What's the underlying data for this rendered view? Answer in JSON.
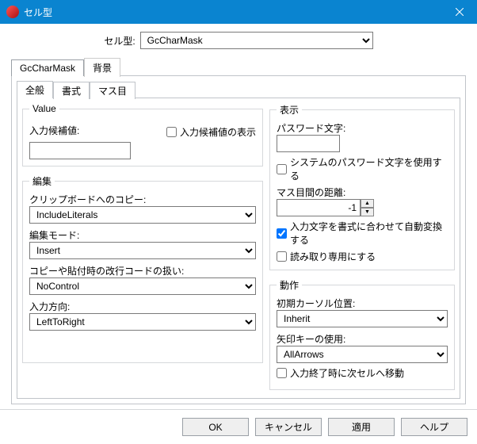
{
  "titlebar": {
    "title": "セル型"
  },
  "celltype": {
    "label": "セル型:",
    "value": "GcCharMask"
  },
  "mainTabs": [
    {
      "label": "GcCharMask"
    },
    {
      "label": "背景"
    }
  ],
  "subTabs": [
    {
      "label": "全般"
    },
    {
      "label": "書式"
    },
    {
      "label": "マス目"
    }
  ],
  "value": {
    "legend": "Value",
    "input_label": "入力候補値:",
    "input_value": "",
    "show_chk": "入力候補値の表示"
  },
  "edit": {
    "legend": "編集",
    "clipboard_label": "クリップボードへのコピー:",
    "clipboard_value": "IncludeLiterals",
    "editmode_label": "編集モード:",
    "editmode_value": "Insert",
    "linebreak_label": "コピーや貼付時の改行コードの扱い:",
    "linebreak_value": "NoControl",
    "direction_label": "入力方向:",
    "direction_value": "LeftToRight"
  },
  "display": {
    "legend": "表示",
    "password_label": "パスワード文字:",
    "password_value": "",
    "syspw_chk": "システムのパスワード文字を使用する",
    "spacing_label": "マス目間の距離:",
    "spacing_value": "-1",
    "autoconvert_chk": "入力文字を書式に合わせて自動変換する",
    "readonly_chk": "読み取り専用にする"
  },
  "action": {
    "legend": "動作",
    "cursor_label": "初期カーソル位置:",
    "cursor_value": "Inherit",
    "arrow_label": "矢印キーの使用:",
    "arrow_value": "AllArrows",
    "exit_chk": "入力終了時に次セルへ移動"
  },
  "buttons": {
    "ok": "OK",
    "cancel": "キャンセル",
    "apply": "適用",
    "help": "ヘルプ"
  }
}
